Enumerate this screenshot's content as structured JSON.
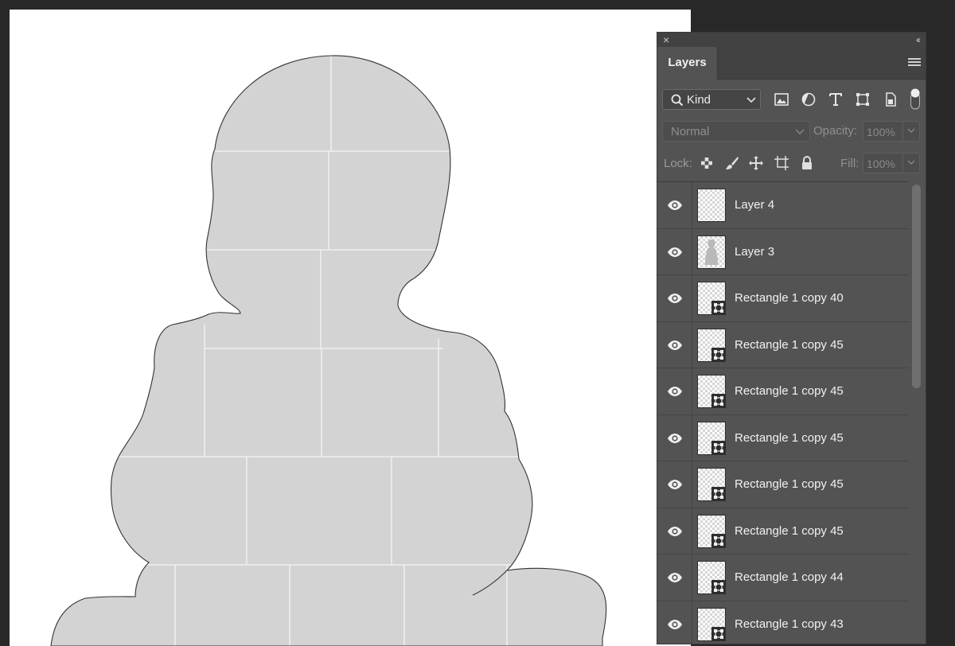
{
  "panel": {
    "close_glyph": "×",
    "collapse_glyph": "‹‹",
    "tab_label": "Layers"
  },
  "filter": {
    "kind_label": "Kind",
    "icons": [
      "image-filter-icon",
      "adjustment-filter-icon",
      "type-filter-icon",
      "shape-filter-icon",
      "smart-object-filter-icon"
    ]
  },
  "blend": {
    "mode": "Normal",
    "opacity_label": "Opacity:",
    "opacity_value": "100%"
  },
  "lock": {
    "label": "Lock:",
    "fill_label": "Fill:",
    "fill_value": "100%",
    "icons": [
      "lock-transparent-pixels-icon",
      "lock-image-pixels-icon",
      "lock-position-icon",
      "lock-artboard-icon",
      "lock-all-icon"
    ]
  },
  "layers": [
    {
      "name": "Layer 4",
      "thumb": "empty"
    },
    {
      "name": "Layer 3",
      "thumb": "silhouette"
    },
    {
      "name": "Rectangle 1 copy 40",
      "thumb": "shape"
    },
    {
      "name": "Rectangle 1 copy 45",
      "thumb": "shape"
    },
    {
      "name": "Rectangle 1 copy 45",
      "thumb": "shape"
    },
    {
      "name": "Rectangle 1 copy 45",
      "thumb": "shape"
    },
    {
      "name": "Rectangle 1 copy 45",
      "thumb": "shape"
    },
    {
      "name": "Rectangle 1 copy 45",
      "thumb": "shape"
    },
    {
      "name": "Rectangle 1 copy 44",
      "thumb": "shape"
    },
    {
      "name": "Rectangle 1 copy 43",
      "thumb": "shape"
    }
  ],
  "colors": {
    "workspace": "#282828",
    "document": "#ffffff",
    "panel": "#535353",
    "silhouette_fill": "#d3d3d3"
  }
}
